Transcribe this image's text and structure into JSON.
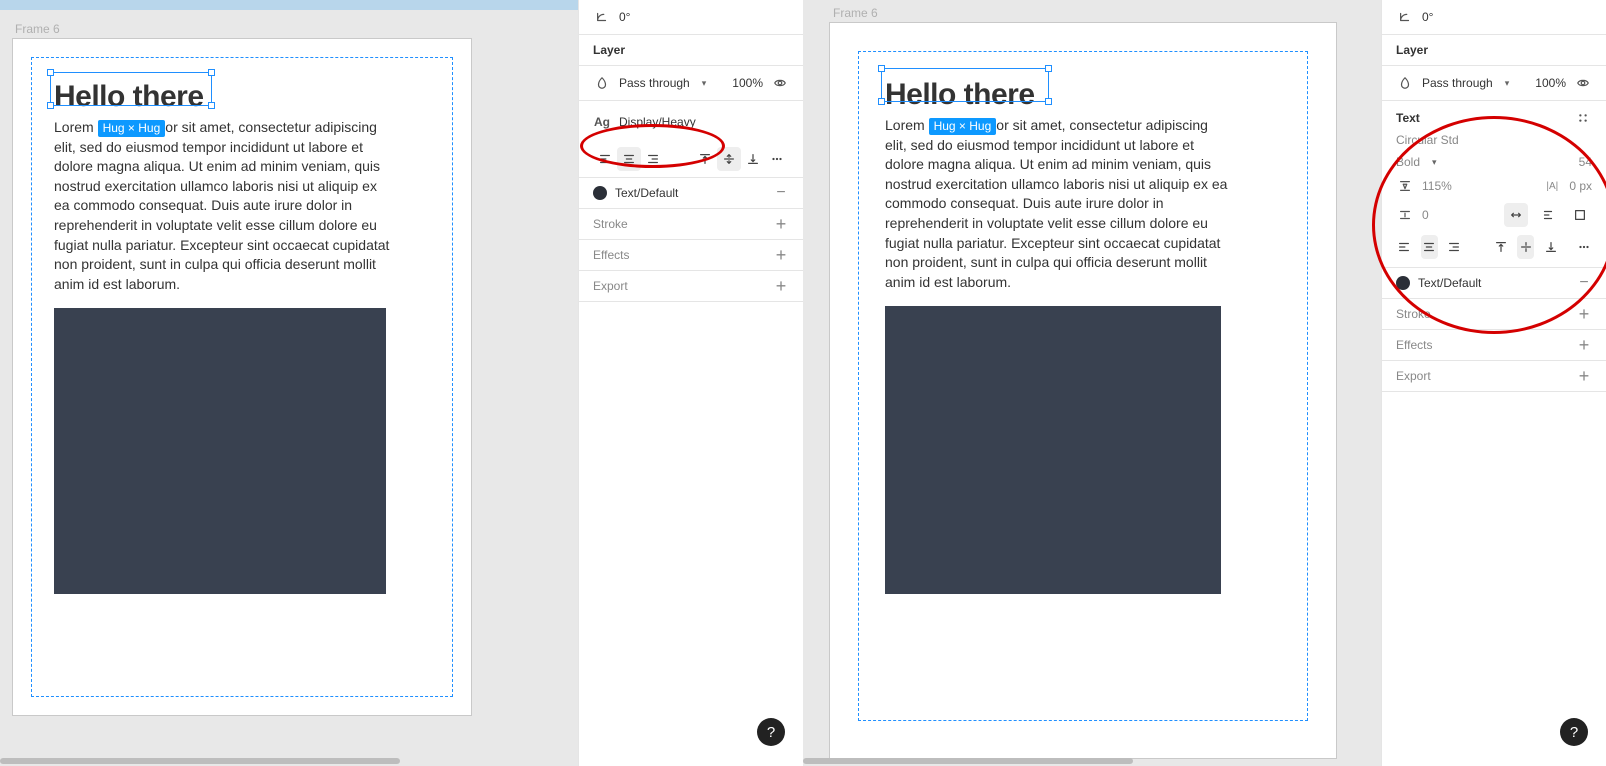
{
  "frame_label": "Frame 6",
  "heading": "Hello there",
  "hug_tag": "Hug × Hug",
  "body_pre": "Lorem ",
  "body_post": "or sit amet, consectetur adipiscing elit, sed do eiusmod tempor incididunt ut labore et dolore magna aliqua. Ut enim ad minim veniam, quis nostrud exercitation ullamco laboris nisi ut aliquip ex ea commodo consequat. Duis aute irure dolor in reprehenderit in voluptate velit esse cillum dolore eu fugiat nulla pariatur. Excepteur sint occaecat cupidatat non proident, sunt in culpa qui officia deserunt mollit anim id est laborum.",
  "panel": {
    "rotation": "0°",
    "layer_label": "Layer",
    "blend_mode": "Pass through",
    "opacity": "100%",
    "text_style": "Display/Heavy",
    "fill_label": "Text/Default",
    "stroke": "Stroke",
    "effects": "Effects",
    "export": "Export"
  },
  "textpanel": {
    "title": "Text",
    "font": "Circular Std",
    "weight": "Bold",
    "size": "54",
    "line_height": "115%",
    "letter_spacing": "0 px",
    "paragraph_spacing": "0"
  },
  "help_glyph": "?"
}
